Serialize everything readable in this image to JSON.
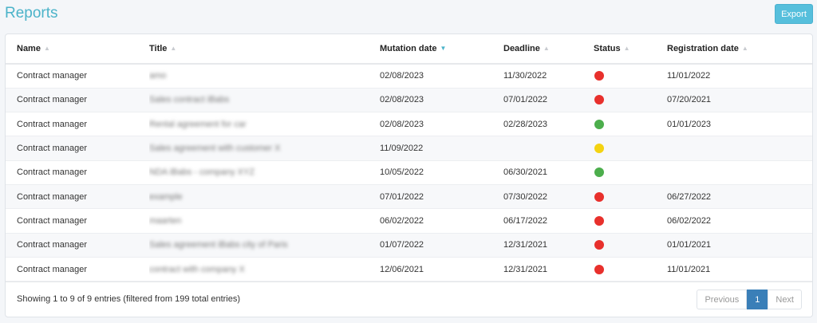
{
  "page": {
    "title": "Reports",
    "export_label": "Export"
  },
  "colors": {
    "red": "#e8302c",
    "green": "#4cae4c",
    "yellow": "#f4d311",
    "accent": "#4bb3c9",
    "pager_active": "#3a7fb8"
  },
  "table": {
    "headers": {
      "name": "Name",
      "title": "Title",
      "mutation": "Mutation date",
      "deadline": "Deadline",
      "status": "Status",
      "registration": "Registration date"
    },
    "sort": {
      "column": "mutation",
      "direction": "desc"
    },
    "rows": [
      {
        "name": "Contract manager",
        "title": "amo",
        "mutation": "02/08/2023",
        "deadline": "11/30/2022",
        "status": "red",
        "registration": "11/01/2022"
      },
      {
        "name": "Contract manager",
        "title": "Sales contract iBabs",
        "mutation": "02/08/2023",
        "deadline": "07/01/2022",
        "status": "red",
        "registration": "07/20/2021"
      },
      {
        "name": "Contract manager",
        "title": "Rental agreement for car",
        "mutation": "02/08/2023",
        "deadline": "02/28/2023",
        "status": "green",
        "registration": "01/01/2023"
      },
      {
        "name": "Contract manager",
        "title": "Sales agreement with customer X",
        "mutation": "11/09/2022",
        "deadline": "",
        "status": "yellow",
        "registration": ""
      },
      {
        "name": "Contract manager",
        "title": "NDA iBabs - company XYZ",
        "mutation": "10/05/2022",
        "deadline": "06/30/2021",
        "status": "green",
        "registration": ""
      },
      {
        "name": "Contract manager",
        "title": "example",
        "mutation": "07/01/2022",
        "deadline": "07/30/2022",
        "status": "red",
        "registration": "06/27/2022"
      },
      {
        "name": "Contract manager",
        "title": "maarten",
        "mutation": "06/02/2022",
        "deadline": "06/17/2022",
        "status": "red",
        "registration": "06/02/2022"
      },
      {
        "name": "Contract manager",
        "title": "Sales agreement iBabs city of Paris",
        "mutation": "01/07/2022",
        "deadline": "12/31/2021",
        "status": "red",
        "registration": "01/01/2021"
      },
      {
        "name": "Contract manager",
        "title": "contract with company X",
        "mutation": "12/06/2021",
        "deadline": "12/31/2021",
        "status": "red",
        "registration": "11/01/2021"
      }
    ]
  },
  "footer": {
    "info": "Showing 1 to 9 of 9 entries (filtered from 199 total entries)",
    "previous": "Previous",
    "page": "1",
    "next": "Next"
  }
}
